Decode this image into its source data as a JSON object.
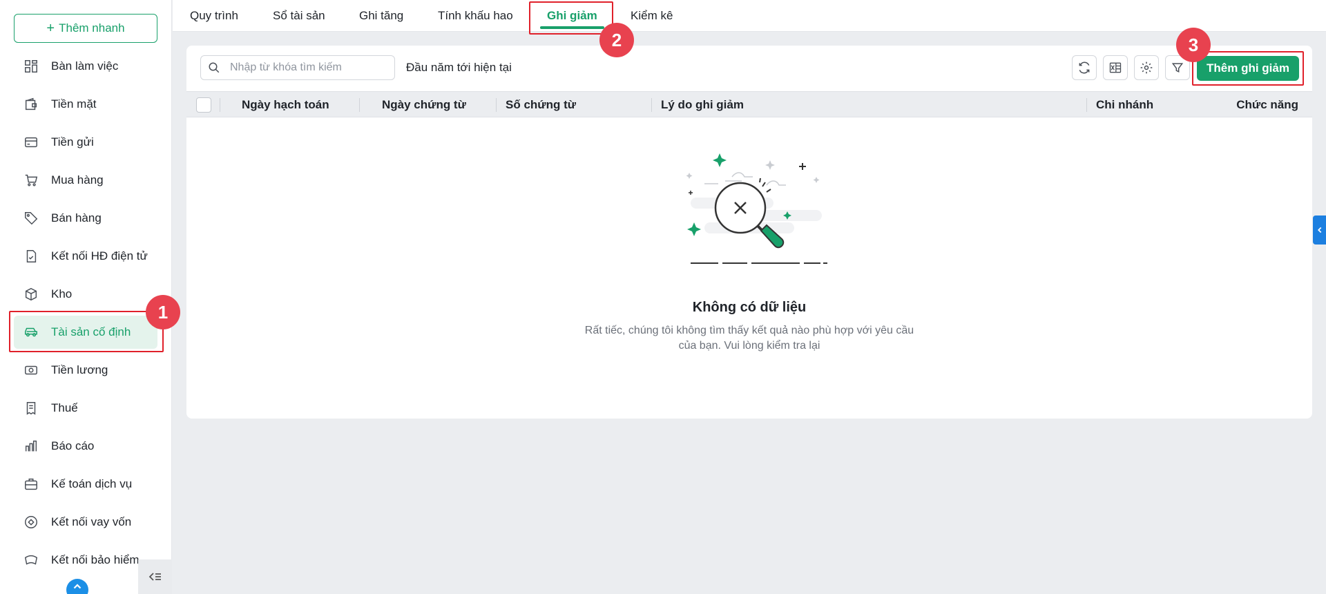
{
  "sidebar": {
    "quick_add_label": "Thêm nhanh",
    "items": [
      {
        "label": "Bàn làm việc",
        "icon": "dashboard-icon"
      },
      {
        "label": "Tiền mặt",
        "icon": "wallet-icon"
      },
      {
        "label": "Tiền gửi",
        "icon": "card-icon"
      },
      {
        "label": "Mua hàng",
        "icon": "cart-icon"
      },
      {
        "label": "Bán hàng",
        "icon": "tag-icon"
      },
      {
        "label": "Kết nối HĐ điện tử",
        "icon": "invoice-icon"
      },
      {
        "label": "Kho",
        "icon": "box-icon"
      },
      {
        "label": "Tài sản cố định",
        "icon": "car-icon",
        "active": true
      },
      {
        "label": "Tiền lương",
        "icon": "money-icon"
      },
      {
        "label": "Thuế",
        "icon": "receipt-icon"
      },
      {
        "label": "Báo cáo",
        "icon": "bar-chart-icon"
      },
      {
        "label": "Kế toán dịch vụ",
        "icon": "briefcase-icon"
      },
      {
        "label": "Kết nối vay vốn",
        "icon": "loan-icon"
      },
      {
        "label": "Kết nối bảo hiểm",
        "icon": "insurance-icon"
      }
    ]
  },
  "tabs": [
    {
      "label": "Quy trình"
    },
    {
      "label": "Sổ tài sản"
    },
    {
      "label": "Ghi tăng"
    },
    {
      "label": "Tính khấu hao"
    },
    {
      "label": "Ghi giảm",
      "active": true
    },
    {
      "label": "Kiểm kê"
    }
  ],
  "toolbar": {
    "search_placeholder": "Nhập từ khóa tìm kiếm",
    "period": "Đầu năm tới hiện tại",
    "add_label": "Thêm ghi giảm"
  },
  "table": {
    "columns": [
      "Ngày hạch toán",
      "Ngày chứng từ",
      "Số chứng từ",
      "Lý do ghi giảm",
      "Chi nhánh",
      "Chức năng"
    ]
  },
  "empty": {
    "title": "Không có dữ liệu",
    "description": "Rất tiếc, chúng tôi không tìm thấy kết quả nào phù hợp với yêu cầu của bạn. Vui lòng kiểm tra lại"
  },
  "badges": [
    "1",
    "2",
    "3"
  ],
  "colors": {
    "accent": "#18a06a",
    "highlight": "#e0202a",
    "badge": "#e8424f"
  }
}
